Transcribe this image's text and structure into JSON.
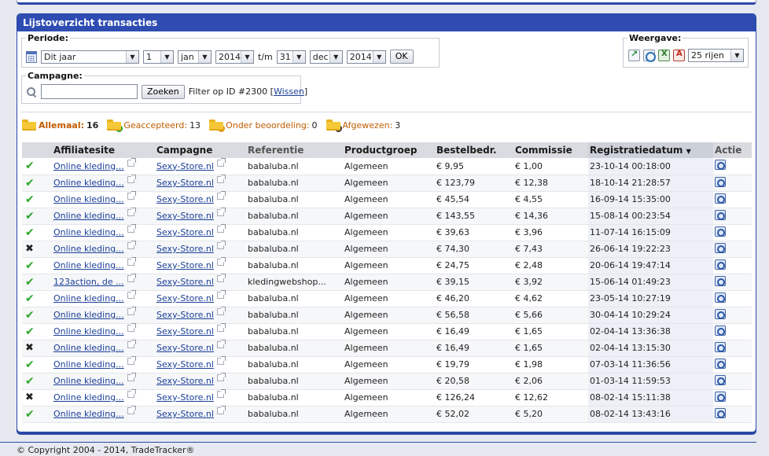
{
  "panel": {
    "title": "Lijstoverzicht transacties"
  },
  "periode": {
    "label": "Periode:",
    "preset": "Dit jaar",
    "from_day": "1",
    "from_month": "jan",
    "from_year": "2014",
    "separator": "t/m",
    "to_day": "31",
    "to_month": "dec",
    "to_year": "2014",
    "ok_label": "OK"
  },
  "weergave": {
    "label": "Weergave:",
    "rows": "25 rijen"
  },
  "campagne": {
    "label": "Campagne:",
    "search_value": "",
    "search_label": "Zoeken",
    "filter_text": "Filter op ID #2300",
    "clear_label": "Wissen"
  },
  "status": {
    "all_label": "Allemaal:",
    "all_count": "16",
    "accepted_label": "Geaccepteerd:",
    "accepted_count": "13",
    "pending_label": "Onder beoordeling:",
    "pending_count": "0",
    "rejected_label": "Afgewezen:",
    "rejected_count": "3"
  },
  "columns": [
    "",
    "Affiliatesite",
    "Campagne",
    "Referentie",
    "Productgroep",
    "Bestelbedr.",
    "Commissie",
    "Registratiedatum",
    "Actie"
  ],
  "rows": [
    {
      "status": "accepted",
      "site": "Online kleding...",
      "campaign": "Sexy-Store.nl",
      "reference": "babaluba.nl",
      "group": "Algemeen",
      "amount": "€ 9,95",
      "commission": "€ 1,00",
      "date": "23-10-14 00:18:00"
    },
    {
      "status": "accepted",
      "site": "Online kleding...",
      "campaign": "Sexy-Store.nl",
      "reference": "babaluba.nl",
      "group": "Algemeen",
      "amount": "€ 123,79",
      "commission": "€ 12,38",
      "date": "18-10-14 21:28:57"
    },
    {
      "status": "accepted",
      "site": "Online kleding...",
      "campaign": "Sexy-Store.nl",
      "reference": "babaluba.nl",
      "group": "Algemeen",
      "amount": "€ 45,54",
      "commission": "€ 4,55",
      "date": "16-09-14 15:35:00"
    },
    {
      "status": "accepted",
      "site": "Online kleding...",
      "campaign": "Sexy-Store.nl",
      "reference": "babaluba.nl",
      "group": "Algemeen",
      "amount": "€ 143,55",
      "commission": "€ 14,36",
      "date": "15-08-14 00:23:54"
    },
    {
      "status": "accepted",
      "site": "Online kleding...",
      "campaign": "Sexy-Store.nl",
      "reference": "babaluba.nl",
      "group": "Algemeen",
      "amount": "€ 39,63",
      "commission": "€ 3,96",
      "date": "11-07-14 16:15:09"
    },
    {
      "status": "rejected",
      "site": "Online kleding...",
      "campaign": "Sexy-Store.nl",
      "reference": "babaluba.nl",
      "group": "Algemeen",
      "amount": "€ 74,30",
      "commission": "€ 7,43",
      "date": "26-06-14 19:22:23"
    },
    {
      "status": "accepted",
      "site": "Online kleding...",
      "campaign": "Sexy-Store.nl",
      "reference": "babaluba.nl",
      "group": "Algemeen",
      "amount": "€ 24,75",
      "commission": "€ 2,48",
      "date": "20-06-14 19:47:14"
    },
    {
      "status": "accepted",
      "site": "123action, de ...",
      "campaign": "Sexy-Store.nl",
      "reference": "kledingwebshop...",
      "group": "Algemeen",
      "amount": "€ 39,15",
      "commission": "€ 3,92",
      "date": "15-06-14 01:49:23"
    },
    {
      "status": "accepted",
      "site": "Online kleding...",
      "campaign": "Sexy-Store.nl",
      "reference": "babaluba.nl",
      "group": "Algemeen",
      "amount": "€ 46,20",
      "commission": "€ 4,62",
      "date": "23-05-14 10:27:19"
    },
    {
      "status": "accepted",
      "site": "Online kleding...",
      "campaign": "Sexy-Store.nl",
      "reference": "babaluba.nl",
      "group": "Algemeen",
      "amount": "€ 56,58",
      "commission": "€ 5,66",
      "date": "30-04-14 10:29:24"
    },
    {
      "status": "accepted",
      "site": "Online kleding...",
      "campaign": "Sexy-Store.nl",
      "reference": "babaluba.nl",
      "group": "Algemeen",
      "amount": "€ 16,49",
      "commission": "€ 1,65",
      "date": "02-04-14 13:36:38"
    },
    {
      "status": "rejected",
      "site": "Online kleding...",
      "campaign": "Sexy-Store.nl",
      "reference": "babaluba.nl",
      "group": "Algemeen",
      "amount": "€ 16,49",
      "commission": "€ 1,65",
      "date": "02-04-14 13:15:30"
    },
    {
      "status": "accepted",
      "site": "Online kleding...",
      "campaign": "Sexy-Store.nl",
      "reference": "babaluba.nl",
      "group": "Algemeen",
      "amount": "€ 19,79",
      "commission": "€ 1,98",
      "date": "07-03-14 11:36:56"
    },
    {
      "status": "accepted",
      "site": "Online kleding...",
      "campaign": "Sexy-Store.nl",
      "reference": "babaluba.nl",
      "group": "Algemeen",
      "amount": "€ 20,58",
      "commission": "€ 2,06",
      "date": "01-03-14 11:59:53"
    },
    {
      "status": "rejected",
      "site": "Online kleding...",
      "campaign": "Sexy-Store.nl",
      "reference": "babaluba.nl",
      "group": "Algemeen",
      "amount": "€ 126,24",
      "commission": "€ 12,62",
      "date": "08-02-14 15:11:38"
    },
    {
      "status": "accepted",
      "site": "Online kleding...",
      "campaign": "Sexy-Store.nl",
      "reference": "babaluba.nl",
      "group": "Algemeen",
      "amount": "€ 52,02",
      "commission": "€ 5,20",
      "date": "08-02-14 13:43:16"
    }
  ],
  "icons": {
    "accepted": "check-icon",
    "rejected": "cross-icon",
    "accent": "#2e4cb2",
    "accepted_color": "#2fa52c"
  },
  "footer": {
    "copyright": "© Copyright 2004 - 2014, TradeTracker®"
  }
}
